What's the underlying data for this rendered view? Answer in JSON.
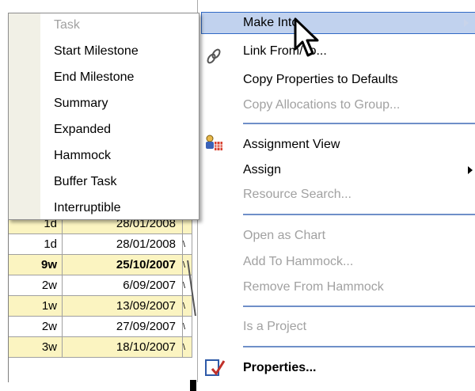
{
  "grid": {
    "rows": [
      {
        "dur": "1d",
        "date": "28/01/2008",
        "bar": "",
        "highlight": true,
        "bold": false
      },
      {
        "dur": "1d",
        "date": "28/01/2008",
        "bar": "\\",
        "highlight": false,
        "bold": false
      },
      {
        "dur": "9w",
        "date": "25/10/2007",
        "bar": "\\",
        "highlight": true,
        "bold": true
      },
      {
        "dur": "2w",
        "date": "6/09/2007",
        "bar": "\\",
        "highlight": false,
        "bold": false
      },
      {
        "dur": "1w",
        "date": "13/09/2007",
        "bar": "\\",
        "highlight": true,
        "bold": false
      },
      {
        "dur": "2w",
        "date": "27/09/2007",
        "bar": "\\",
        "highlight": false,
        "bold": false
      },
      {
        "dur": "3w",
        "date": "18/10/2007",
        "bar": "\\",
        "highlight": true,
        "bold": false
      }
    ]
  },
  "menu": {
    "items": [
      {
        "label": "Make Into",
        "state": "highlighted",
        "submenu": true
      },
      {
        "label": "Link From/To...",
        "state": "enabled",
        "icon": "link-icon"
      },
      {
        "label": "Copy Properties to Defaults",
        "state": "enabled"
      },
      {
        "label": "Copy Allocations to Group...",
        "state": "disabled"
      },
      {
        "label": "Assignment View",
        "state": "enabled",
        "icon": "assignment-icon"
      },
      {
        "label": "Assign",
        "state": "enabled",
        "submenu": true
      },
      {
        "label": "Resource Search...",
        "state": "disabled"
      },
      {
        "label": "Open as Chart",
        "state": "disabled"
      },
      {
        "label": "Add To Hammock...",
        "state": "disabled"
      },
      {
        "label": "Remove From Hammock",
        "state": "disabled"
      },
      {
        "label": "Is a Project",
        "state": "disabled"
      },
      {
        "label": "Properties...",
        "state": "enabled",
        "bold": true,
        "icon": "properties-icon"
      }
    ]
  },
  "submenu": {
    "items": [
      {
        "label": "Task",
        "state": "disabled"
      },
      {
        "label": "Start Milestone",
        "state": "enabled"
      },
      {
        "label": "End Milestone",
        "state": "enabled"
      },
      {
        "label": "Summary",
        "state": "enabled"
      },
      {
        "label": "Expanded",
        "state": "enabled"
      },
      {
        "label": "Hammock",
        "state": "enabled"
      },
      {
        "label": "Buffer Task",
        "state": "enabled"
      },
      {
        "label": "Interruptible",
        "state": "enabled"
      }
    ]
  },
  "colors": {
    "highlight_fill": "#c1d2ee",
    "highlight_border": "#316ac5",
    "separator": "#6f8fc8",
    "disabled_text": "#a1a1a1",
    "row_highlight": "#fbf4c1"
  }
}
